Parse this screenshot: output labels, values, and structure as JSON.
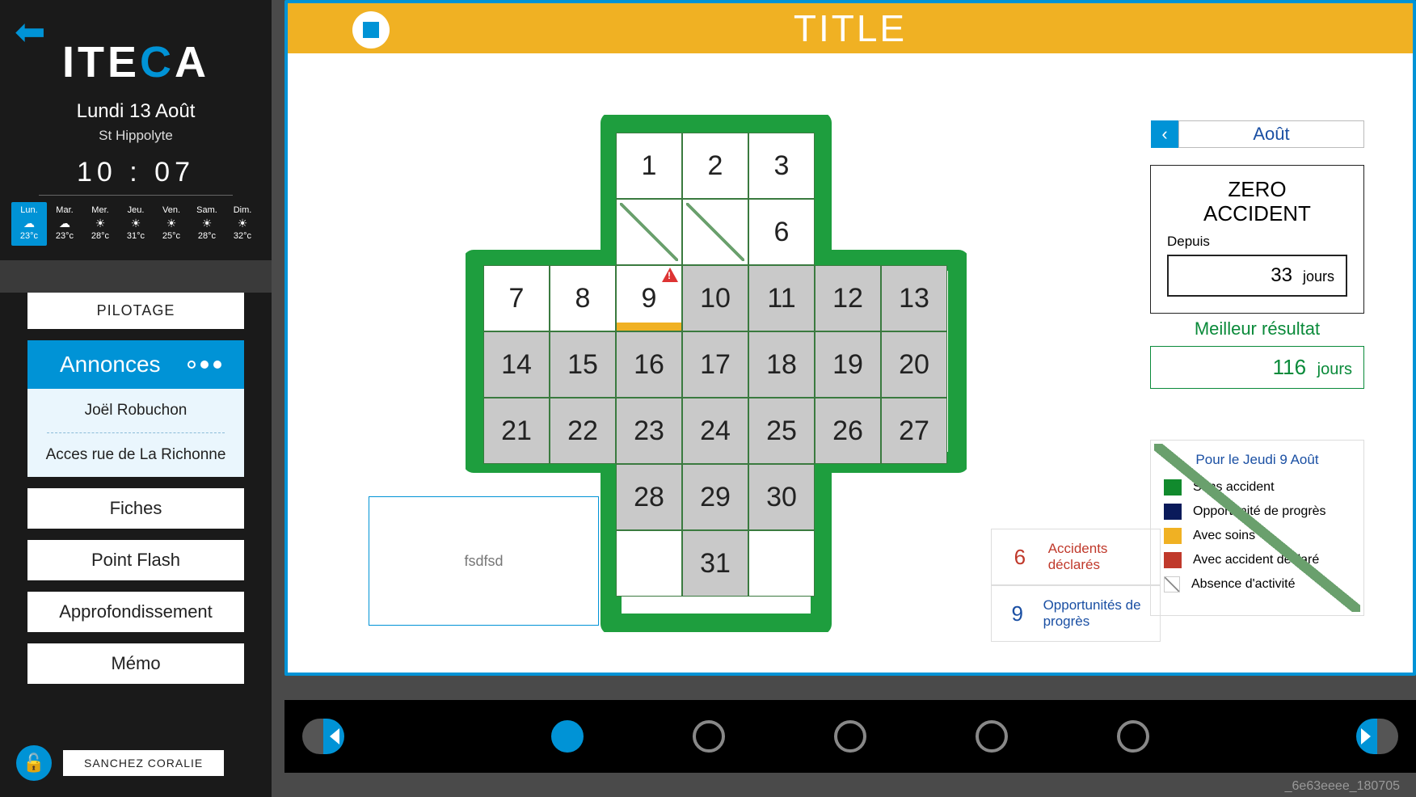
{
  "logo": {
    "pre": "ITE",
    "c": "C",
    "post": "A"
  },
  "sidebar": {
    "date_main": "Lundi 13 Août",
    "date_sub": "St Hippolyte",
    "clock": "10 : 07",
    "weather": [
      {
        "d": "Lun.",
        "t": "23°c",
        "active": true,
        "ico": "☁"
      },
      {
        "d": "Mar.",
        "t": "23°c",
        "active": false,
        "ico": "☁"
      },
      {
        "d": "Mer.",
        "t": "28°c",
        "active": false,
        "ico": "☀"
      },
      {
        "d": "Jeu.",
        "t": "31°c",
        "active": false,
        "ico": "☀"
      },
      {
        "d": "Ven.",
        "t": "25°c",
        "active": false,
        "ico": "☀"
      },
      {
        "d": "Sam.",
        "t": "28°c",
        "active": false,
        "ico": "☀"
      },
      {
        "d": "Dim.",
        "t": "32°c",
        "active": false,
        "ico": "☀"
      }
    ],
    "nav": {
      "pilotage": "PILOTAGE",
      "annonces": "Annonces",
      "annonce1": "Joël Robuchon",
      "annonce2": "Acces rue de La Richonne",
      "fiches": "Fiches",
      "pointflash": "Point Flash",
      "approf": "Approfondissement",
      "memo": "Mémo"
    },
    "user": "SANCHEZ CORALIE"
  },
  "main": {
    "title": "TITLE",
    "note": "fsdfsd",
    "accidents": {
      "n": "6",
      "label": "Accidents déclarés"
    },
    "opps": {
      "n": "9",
      "label": "Opportunités de progrès"
    },
    "month": "Août",
    "zero": {
      "title1": "ZERO",
      "title2": "ACCIDENT",
      "depuis": "Depuis",
      "n": "33",
      "unit": "jours"
    },
    "best": {
      "label": "Meilleur résultat",
      "n": "116",
      "unit": "jours"
    },
    "legend": {
      "header": "Pour le Jeudi 9 Août",
      "sans": "Sans accident",
      "opp": "Opportunité de progrès",
      "soins": "Avec soins",
      "decl": "Avec accident déclaré",
      "abs": "Absence d'activité"
    },
    "calendar_layout": [
      [
        null,
        null,
        1,
        2,
        3,
        null,
        null
      ],
      [
        null,
        null,
        "d",
        "d",
        6,
        null,
        null
      ],
      [
        7,
        8,
        "9!",
        10,
        11,
        12,
        13
      ],
      [
        14,
        15,
        16,
        17,
        18,
        19,
        20
      ],
      [
        21,
        22,
        23,
        24,
        25,
        26,
        27
      ],
      [
        null,
        null,
        28,
        29,
        30,
        null,
        null
      ],
      [
        null,
        null,
        "e",
        31,
        "e",
        null,
        null
      ]
    ],
    "grey_from": 10
  },
  "footer": {
    "tag": "_6e63eeee_180705",
    "dots": 5,
    "active_dot": 0
  }
}
